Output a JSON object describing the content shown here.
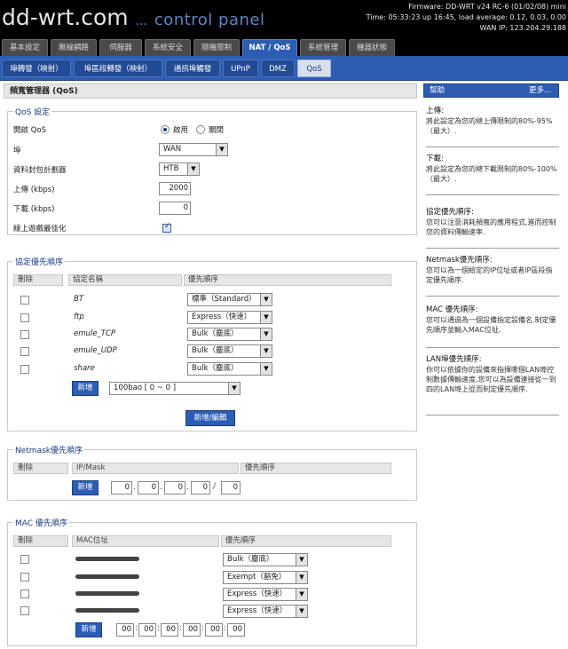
{
  "header": {
    "logo_main": "dd-wrt.com",
    "logo_dots": "...",
    "logo_sub": "control panel",
    "firmware": "Firmware: DD-WRT v24 RC-6 (01/02/08) mini",
    "time": "Time: 05:33:23 up 16:45, load average: 0.12, 0.03, 0.00",
    "wan_ip": "WAN IP: 123.204.29.188"
  },
  "main_tabs": [
    "基本設定",
    "無線網路",
    "伺服器",
    "系統安全",
    "隨機限制",
    "NAT / QoS",
    "系統管理",
    "機器狀態"
  ],
  "sub_tabs": [
    "埠轉發（映射）",
    "埠區段轉發（映射）",
    "通訊埠觸發",
    "UPnP",
    "DMZ",
    "QoS"
  ],
  "page_title": "頻寬管理器 (QoS)",
  "qos_settings": {
    "legend": "QoS 設定",
    "enable_label": "開啟 QoS",
    "enable_on": "啟用",
    "enable_off": "關閉",
    "port_label": "埠",
    "port_value": "WAN",
    "scheduler_label": "資料封包計劃器",
    "scheduler_value": "HTB",
    "upload_label": "上傳 (kbps)",
    "upload_value": "2000",
    "download_label": "下載 (kbps)",
    "download_value": "0",
    "gaming_label": "線上遊戲最佳化"
  },
  "service_priority": {
    "legend": "協定優先順序",
    "col_delete": "刪除",
    "col_name": "協定名稱",
    "col_priority": "優先順序",
    "rows": [
      {
        "name": "BT",
        "priority": "標準（Standard）"
      },
      {
        "name": "ftp",
        "priority": "Express（快速）"
      },
      {
        "name": "emule_TCP",
        "priority": "Bulk（塵底）"
      },
      {
        "name": "emule_UDP",
        "priority": "Bulk（塵底）"
      },
      {
        "name": "share",
        "priority": "Bulk（塵底）"
      }
    ],
    "add_label": "新增",
    "add_select": "100bao [ 0 ~ 0 ]",
    "add_edit_label": "新增/編輯"
  },
  "netmask_priority": {
    "legend": "Netmask優先順序",
    "col_delete": "刪除",
    "col_ipmask": "IP/Mask",
    "col_priority": "優先順序",
    "add_label": "新增",
    "ip": [
      "0",
      "0",
      "0",
      "0"
    ],
    "mask": "0"
  },
  "mac_priority": {
    "legend": "MAC 優先順序",
    "col_delete": "刪除",
    "col_mac": "MAC位址",
    "col_priority": "優先順序",
    "rows": [
      {
        "priority": "Bulk（塵底）"
      },
      {
        "priority": "Exempt（豁免）"
      },
      {
        "priority": "Express（快速）"
      },
      {
        "priority": "Express（快速）"
      }
    ],
    "add_label": "新增",
    "mac": [
      "00",
      "00",
      "00",
      "00",
      "00",
      "00"
    ]
  },
  "help": {
    "title": "幫助",
    "more": "更多...",
    "sections": [
      {
        "head": "上傳:",
        "body": "將此設定為您的總上傳限制的80%-95%（最大）."
      },
      {
        "head": "下載:",
        "body": "將此設定為您的總下載限制的80%-100%（最大）."
      },
      {
        "head": "協定優先順序:",
        "body": "您可以注意消耗頻寬的應用程式,進而控制您的資料傳輸速率."
      },
      {
        "head": "Netmask優先順序:",
        "body": "您可以為一個給定的IP位址或者IP區段指定優先順序."
      },
      {
        "head": "MAC 優先順序:",
        "body": "您可以通過為一個設備指定設備名,制定優先順序並輸入MAC位址."
      },
      {
        "head": "LAN埠優先順序:",
        "body": "你可以依據你的設備來指揮哪個LAN埠控制數據傳輸速度,您可以為設備連接從一到四的LAN埠上從而制定優先順序."
      }
    ]
  },
  "colors": {
    "accent": "#2d5db3",
    "header_bg": "#000000",
    "legend": "#1d3a80"
  }
}
